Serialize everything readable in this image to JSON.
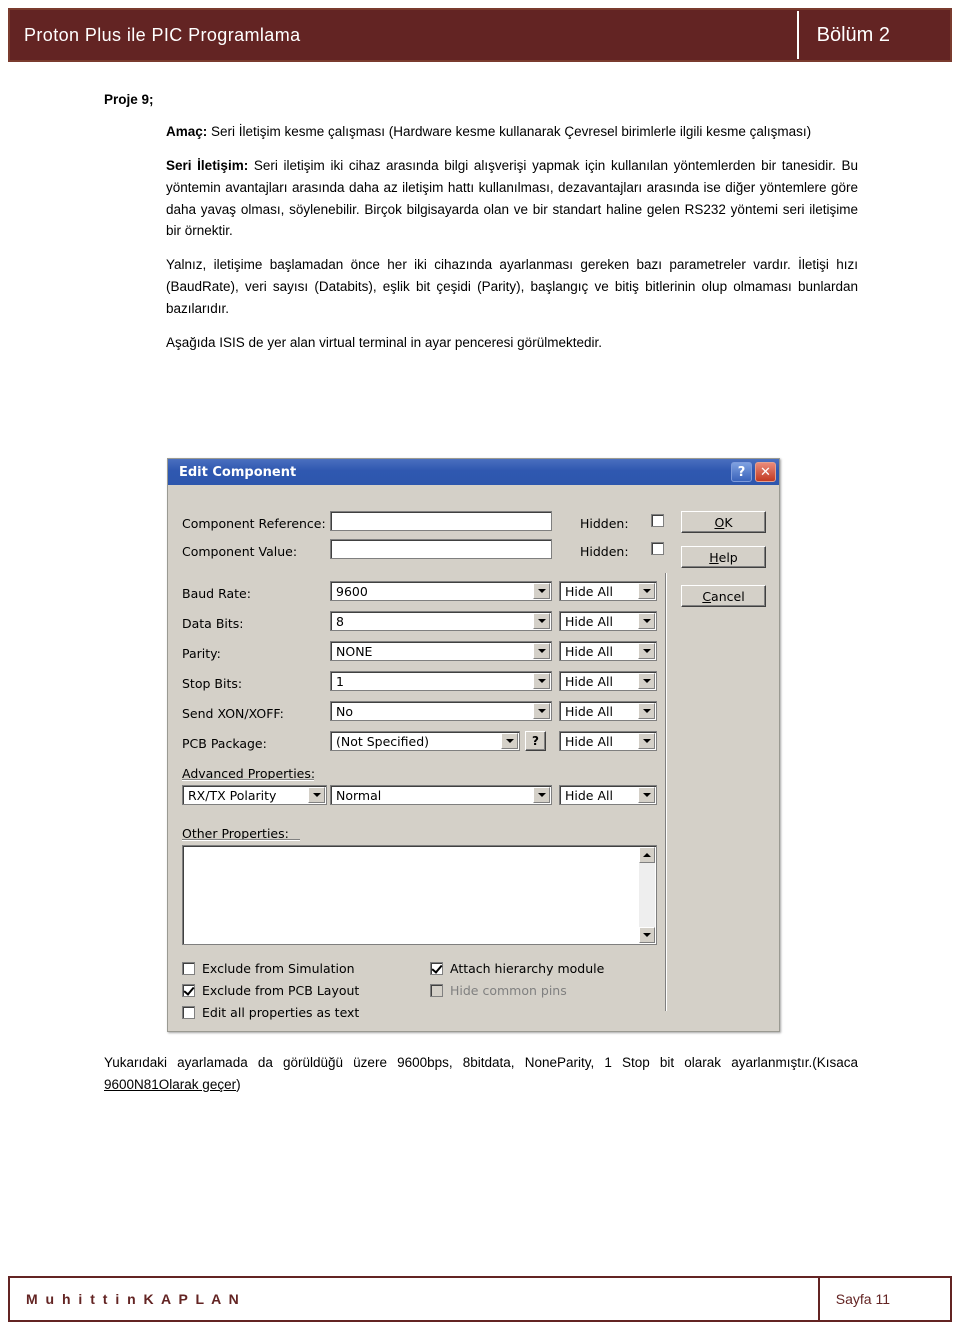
{
  "header": {
    "title": "Proton Plus ile PIC Programlama",
    "chapter": "Bölüm 2"
  },
  "content": {
    "project_label": "Proje 9;",
    "aim_bold": "Amaç:",
    "aim_text": " Seri İletişim kesme çalışması (Hardware kesme kullanarak Çevresel birimlerle ilgili kesme çalışması)",
    "serial_bold": "Seri İletişim:",
    "serial_text": " Seri iletişim iki cihaz arasında bilgi alışverişi yapmak için kullanılan yöntemlerden bir tanesidir. Bu yöntemin avantajları arasında daha az iletişim hattı kullanılması, dezavantajları arasında ise diğer yöntemlere göre daha yavaş olması, söylenebilir. Birçok bilgisayarda olan ve bir standart haline gelen RS232 yöntemi seri iletişime bir örnektir.",
    "params_text": "Yalnız, iletişime başlamadan önce her iki cihazında ayarlanması gereken bazı parametreler vardır. İletişi hızı (BaudRate), veri sayısı (Databits), eşlik bit çeşidi (Parity), başlangıç ve bitiş bitlerinin olup olmaması bunlardan bazılarıdır.",
    "caption_text": "Aşağıda ISIS de yer alan virtual terminal in ayar penceresi görülmektedir.",
    "closing_text_1": "Yukarıdaki ayarlamada da görüldüğü üzere 9600bps, 8bitdata, NoneParity, 1 Stop bit olarak ayarlanmıştır.(Kısaca ",
    "closing_underline": "9600N81Olarak geçer",
    "closing_text_2": ")"
  },
  "dialog": {
    "title": "Edit Component",
    "title_buttons": {
      "help": "?",
      "close": "✕"
    },
    "fields": {
      "component_reference_label": "Component Reference:",
      "component_reference_value": "",
      "component_value_label": "Component Value:",
      "component_value_value": "",
      "baud_rate_label": "Baud Rate:",
      "baud_rate_value": "9600",
      "data_bits_label": "Data Bits:",
      "data_bits_value": "8",
      "parity_label": "Parity:",
      "parity_value": "NONE",
      "stop_bits_label": "Stop Bits:",
      "stop_bits_value": "1",
      "send_xon_label": "Send XON/XOFF:",
      "send_xon_value": "No",
      "pcb_package_label": "PCB Package:",
      "pcb_package_value": "(Not Specified)",
      "pcb_help_button": "?",
      "advanced_properties_label": "Advanced Properties:",
      "advanced_property_name": "RX/TX Polarity",
      "advanced_property_value": "Normal",
      "other_properties_label": "Other Properties:",
      "other_properties_value": ""
    },
    "hidden_labels": {
      "hidden_1": "Hidden:",
      "hidden_2": "Hidden:"
    },
    "hide_all_options": [
      "Hide All",
      "Hide All",
      "Hide All",
      "Hide All",
      "Hide All",
      "Hide All",
      "Hide All"
    ],
    "buttons": {
      "ok": "OK",
      "help": "Help",
      "cancel": "Cancel"
    },
    "checkboxes": {
      "exclude_simulation": "Exclude from Simulation",
      "exclude_pcb": "Exclude from PCB Layout",
      "edit_all_text": "Edit all properties as text",
      "attach_hierarchy": "Attach hierarchy module",
      "hide_common_pins": "Hide common pins"
    }
  },
  "footer": {
    "author": "M u h i t t i n   K A P L A N",
    "page": "Sayfa 11"
  }
}
